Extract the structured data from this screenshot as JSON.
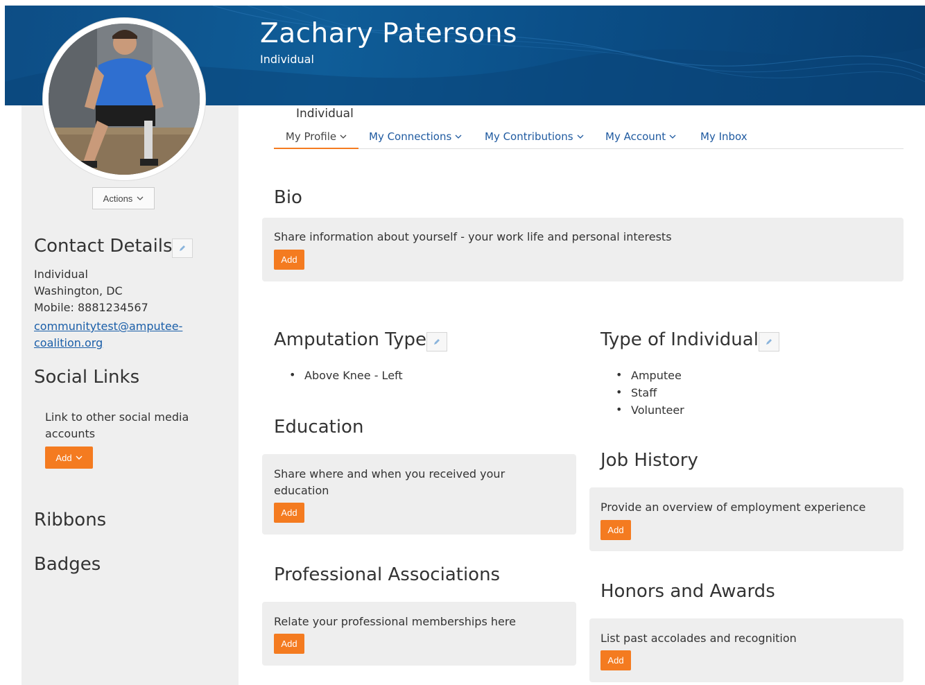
{
  "header": {
    "name": "Zachary Patersons",
    "type": "Individual"
  },
  "sidebar": {
    "actions_label": "Actions",
    "contact": {
      "heading": "Contact Details",
      "lines": [
        "Individual",
        "Washington, DC",
        "Mobile: 8881234567"
      ],
      "email": "communitytest@amputee-coalition.org"
    },
    "social": {
      "heading": "Social Links",
      "text": "Link to other social media accounts",
      "add_label": "Add"
    },
    "ribbons_heading": "Ribbons",
    "badges_heading": "Badges"
  },
  "nav": {
    "heading": "Individual",
    "tabs": [
      {
        "label": "My Profile"
      },
      {
        "label": "My Connections"
      },
      {
        "label": "My Contributions"
      },
      {
        "label": "My Account"
      },
      {
        "label": "My Inbox"
      }
    ]
  },
  "main": {
    "bio": {
      "heading": "Bio",
      "text": "Share information about yourself - your work life and personal interests",
      "add_label": "Add"
    },
    "amputation": {
      "heading": "Amputation Type",
      "items": [
        "Above Knee - Left"
      ]
    },
    "individual_type": {
      "heading": "Type of Individual",
      "items": [
        "Amputee",
        "Staff",
        "Volunteer"
      ]
    },
    "education": {
      "heading": "Education",
      "text": "Share where and when you received your education",
      "add_label": "Add"
    },
    "job_history": {
      "heading": "Job History",
      "text": "Provide an overview of employment experience",
      "add_label": "Add"
    },
    "associations": {
      "heading": "Professional Associations",
      "text": "Relate your professional memberships here",
      "add_label": "Add"
    },
    "honors": {
      "heading": "Honors and Awards",
      "text": "List past accolades and recognition",
      "add_label": "Add"
    }
  },
  "colors": {
    "accent": "#f47b20",
    "banner": "#0f5d98",
    "link": "#1f5aa0"
  },
  "icons": [
    "pencil-icon",
    "chevron-down-icon"
  ]
}
